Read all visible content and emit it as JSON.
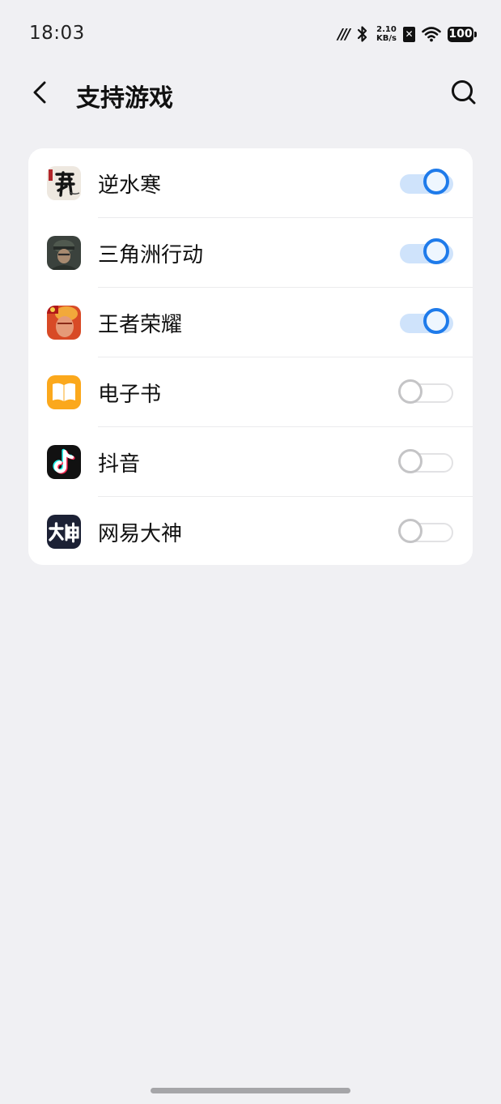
{
  "status_bar": {
    "time": "18:03",
    "net_speed_value": "2.10",
    "net_speed_unit": "KB/s",
    "battery_level": "100"
  },
  "header": {
    "title": "支持游戏"
  },
  "apps": [
    {
      "name": "逆水寒",
      "enabled": true
    },
    {
      "name": "三角洲行动",
      "enabled": true
    },
    {
      "name": "王者荣耀",
      "enabled": true
    },
    {
      "name": "电子书",
      "enabled": false
    },
    {
      "name": "抖音",
      "enabled": false
    },
    {
      "name": "网易大神",
      "enabled": false
    }
  ],
  "colors": {
    "accent": "#1f7bea",
    "background": "#f0f0f3",
    "card": "#ffffff"
  }
}
